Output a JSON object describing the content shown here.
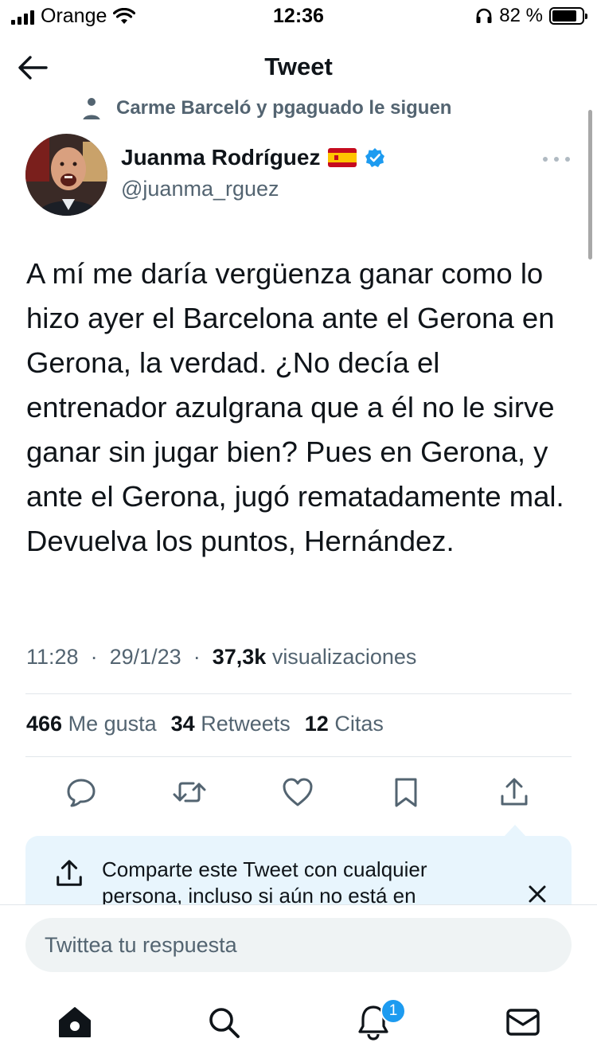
{
  "status_bar": {
    "carrier": "Orange",
    "time": "12:36",
    "battery": "82 %",
    "battery_level": 0.82
  },
  "header": {
    "title": "Tweet",
    "back_icon": "arrow-left-icon"
  },
  "social_context": {
    "text": "Carme Barceló y pgaguado le siguen",
    "icon": "person-icon"
  },
  "author": {
    "name": "Juanma Rodríguez",
    "handle": "@juanma_rguez",
    "flag": "spain-flag-icon",
    "verified_icon": "verified-badge-icon",
    "verified_color": "#1d9bf0"
  },
  "tweet": {
    "text": "A mí me daría vergüenza ganar como lo hizo ayer el Barcelona ante el Gerona en Gerona, la verdad. ¿No decía el entrenador azulgrana que a él no le sirve ganar sin jugar bien? Pues en Gerona, y ante el Gerona, jugó rematadamente mal. Devuelva los puntos, Hernández.",
    "time": "11:28",
    "date": "29/1/23",
    "views_count": "37,3k",
    "views_label": "visualizaciones"
  },
  "stats": {
    "likes_count": "466",
    "likes_label": "Me gusta",
    "retweets_count": "34",
    "retweets_label": "Retweets",
    "quotes_count": "12",
    "quotes_label": "Citas"
  },
  "actions": [
    "reply-icon",
    "retweet-icon",
    "like-icon",
    "bookmark-icon",
    "share-icon"
  ],
  "share_tip": {
    "text": "Comparte este Tweet con cualquier persona, incluso si aún no está en",
    "icon": "share-icon",
    "background": "#e8f5fd"
  },
  "reply": {
    "placeholder": "Twittea tu respuesta"
  },
  "tabbar": {
    "tabs": [
      "home-icon",
      "search-icon",
      "notifications-icon",
      "messages-icon"
    ],
    "notification_badge": "1",
    "accent": "#1d9bf0"
  }
}
